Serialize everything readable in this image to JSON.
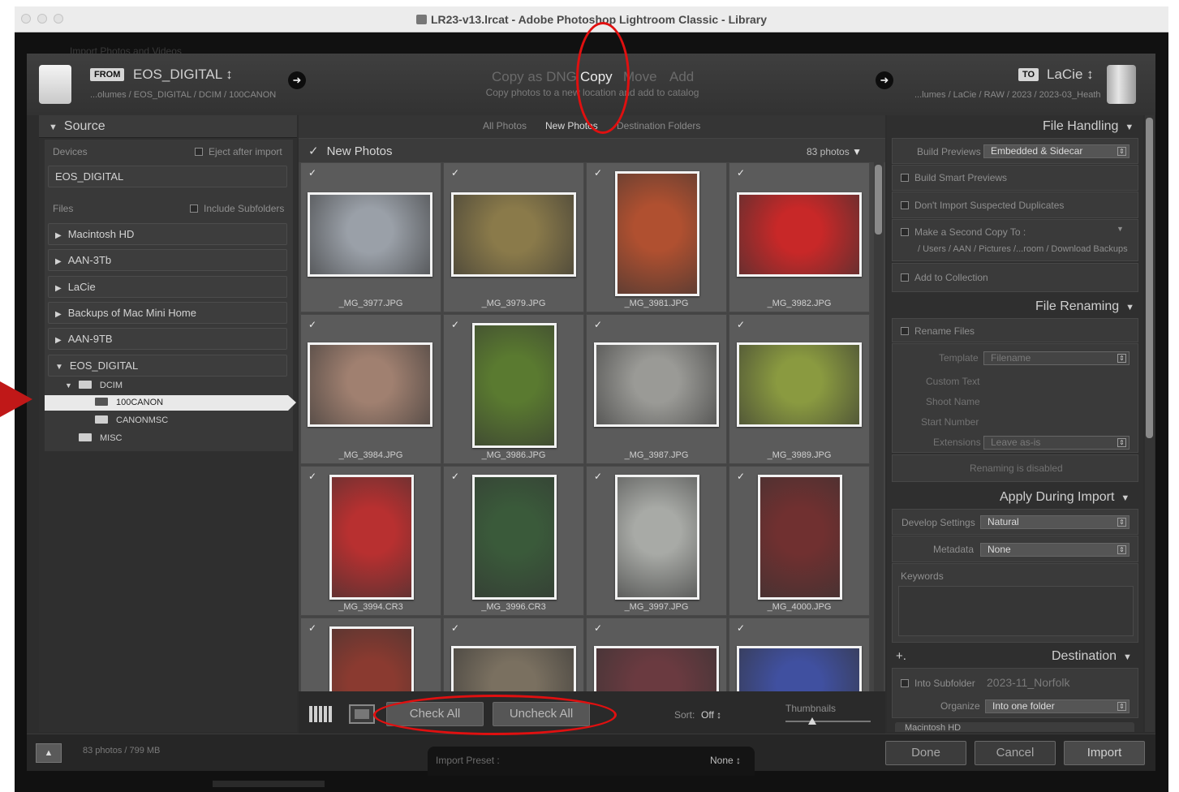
{
  "window": {
    "title": "LR23-v13.lrcat - Adobe Photoshop Lightroom Classic - Library"
  },
  "dialog": {
    "ghost_title": "Import Photos and Videos"
  },
  "from": {
    "badge": "FROM",
    "name": "EOS_DIGITAL ↕",
    "path": "...olumes / EOS_DIGITAL / DCIM / 100CANON"
  },
  "to": {
    "badge": "TO",
    "name": "LaCie ↕",
    "path": "...lumes / LaCie / RAW / 2023 / 2023-03_Heath"
  },
  "modes": {
    "copy_dng": "Copy as DNG",
    "copy": "Copy",
    "move": "Move",
    "add": "Add",
    "description": "Copy photos to a new location and add to catalog"
  },
  "source": {
    "title": "Source",
    "devices_label": "Devices",
    "eject_label": "Eject after import",
    "device": "EOS_DIGITAL",
    "files_label": "Files",
    "include_subfolders": "Include Subfolders",
    "volumes": [
      "Macintosh HD",
      "AAN-3Tb",
      "LaCie",
      "Backups of Mac Mini Home",
      "AAN-9TB",
      "EOS_DIGITAL"
    ],
    "tree": {
      "dcim": "DCIM",
      "f100canon": "100CANON",
      "canonmsc": "CANONMSC",
      "misc": "MISC"
    }
  },
  "view_tabs": {
    "all": "All Photos",
    "new": "New Photos",
    "dest": "Destination Folders"
  },
  "grid": {
    "header": "New Photos",
    "count": "83 photos",
    "photos": [
      {
        "name": "_MG_3977.JPG",
        "color": "#9aa0a8"
      },
      {
        "name": "_MG_3979.JPG",
        "color": "#8a7a4a"
      },
      {
        "name": "_MG_3981.JPG",
        "color": "#b05030"
      },
      {
        "name": "_MG_3982.JPG",
        "color": "#c82828"
      },
      {
        "name": "_MG_3984.JPG",
        "color": "#a08070"
      },
      {
        "name": "_MG_3986.JPG",
        "color": "#5a7a30"
      },
      {
        "name": "_MG_3987.JPG",
        "color": "#9a9a96"
      },
      {
        "name": "_MG_3989.JPG",
        "color": "#8a9a40"
      },
      {
        "name": "_MG_3994.CR3",
        "color": "#b83030"
      },
      {
        "name": "_MG_3996.CR3",
        "color": "#3a5a3a"
      },
      {
        "name": "_MG_3997.JPG",
        "color": "#a8aaa6"
      },
      {
        "name": "_MG_4000.JPG",
        "color": "#703030"
      },
      {
        "name": "",
        "color": "#8a3a30"
      },
      {
        "name": "",
        "color": "#7a7060"
      },
      {
        "name": "",
        "color": "#6a3a40"
      },
      {
        "name": "",
        "color": "#4050a0"
      }
    ]
  },
  "toolbar": {
    "check_all": "Check All",
    "uncheck_all": "Uncheck All",
    "sort_label": "Sort:",
    "sort_value": "Off ↕",
    "thumbnails": "Thumbnails"
  },
  "file_handling": {
    "title": "File Handling",
    "build_previews_label": "Build Previews",
    "build_previews_value": "Embedded & Sidecar",
    "smart_previews": "Build Smart Previews",
    "no_duplicates": "Don't Import Suspected Duplicates",
    "second_copy": "Make a Second Copy To :",
    "second_copy_path": "/ Users / AAN / Pictures /...room / Download Backups",
    "add_collection": "Add to Collection"
  },
  "file_renaming": {
    "title": "File Renaming",
    "rename_files": "Rename Files",
    "template_label": "Template",
    "template_value": "Filename",
    "custom_text": "Custom Text",
    "shoot_name": "Shoot Name",
    "start_number": "Start Number",
    "extensions_label": "Extensions",
    "extensions_value": "Leave as-is",
    "disabled_note": "Renaming is disabled"
  },
  "apply": {
    "title": "Apply During Import",
    "develop_label": "Develop Settings",
    "develop_value": "Natural",
    "metadata_label": "Metadata",
    "metadata_value": "None",
    "keywords_label": "Keywords"
  },
  "destination": {
    "title": "Destination",
    "plus": "+.",
    "into_subfolder": "Into Subfolder",
    "subfolder_value": "2023-11_Norfolk",
    "organize_label": "Organize",
    "organize_value": "Into one folder",
    "partial": "Macintosh HD"
  },
  "bottom": {
    "summary": "83 photos / 799 MB",
    "preset_label": "Import Preset :",
    "preset_value": "None ↕",
    "done": "Done",
    "cancel": "Cancel",
    "import": "Import"
  },
  "colors": {
    "annotation_red": "#e01010"
  }
}
